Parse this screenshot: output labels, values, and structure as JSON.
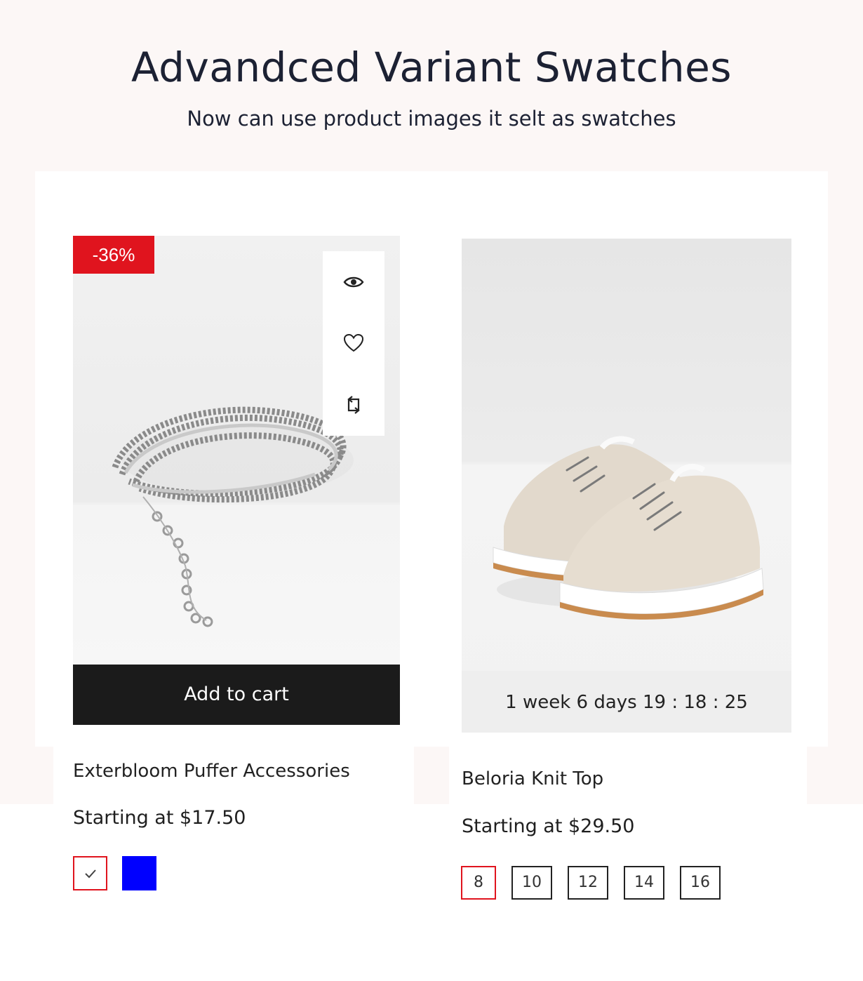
{
  "header": {
    "title": "Advandced Variant Swatches",
    "subtitle": "Now can use product images it selt as swatches"
  },
  "products": [
    {
      "name": "Exterbloom Puffer Accessories",
      "price": "Starting at $17.50",
      "badge": "-36%",
      "add_to_cart_label": "Add to cart",
      "actions": [
        "quick-view-icon",
        "wishlist-heart-icon",
        "compare-icon"
      ],
      "swatches": [
        {
          "color": "#ffffff",
          "selected": true,
          "icon": "check-icon"
        },
        {
          "color": "#0000ff",
          "selected": false
        }
      ]
    },
    {
      "name": "Beloria Knit Top",
      "price": "Starting at $29.50",
      "countdown": "1 week 6 days 19 : 18 : 25",
      "sizes": [
        "8",
        "10",
        "12",
        "14",
        "16"
      ],
      "selected_size": "8"
    }
  ],
  "colors": {
    "accent_red": "#e0141e",
    "button_dark": "#1b1b1b",
    "page_tint": "#fcf7f6",
    "text_dark": "#1c2133"
  }
}
